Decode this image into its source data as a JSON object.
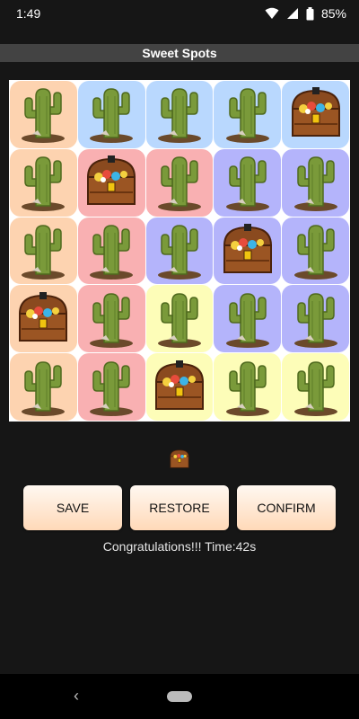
{
  "status": {
    "time": "1:49",
    "battery": "85%"
  },
  "app": {
    "title": "Sweet Spots"
  },
  "board": {
    "rows": [
      [
        {
          "color": "orange",
          "item": "cactus"
        },
        {
          "color": "blue",
          "item": "cactus"
        },
        {
          "color": "blue",
          "item": "cactus"
        },
        {
          "color": "blue",
          "item": "cactus"
        },
        {
          "color": "blue",
          "item": "chest"
        }
      ],
      [
        {
          "color": "orange",
          "item": "cactus"
        },
        {
          "color": "pink",
          "item": "chest"
        },
        {
          "color": "pink",
          "item": "cactus"
        },
        {
          "color": "purple",
          "item": "cactus"
        },
        {
          "color": "purple",
          "item": "cactus"
        }
      ],
      [
        {
          "color": "orange",
          "item": "cactus"
        },
        {
          "color": "pink",
          "item": "cactus"
        },
        {
          "color": "purple",
          "item": "cactus"
        },
        {
          "color": "purple",
          "item": "chest"
        },
        {
          "color": "purple",
          "item": "cactus"
        }
      ],
      [
        {
          "color": "orange",
          "item": "chest"
        },
        {
          "color": "pink",
          "item": "cactus"
        },
        {
          "color": "yellow",
          "item": "cactus"
        },
        {
          "color": "purple",
          "item": "cactus"
        },
        {
          "color": "purple",
          "item": "cactus"
        }
      ],
      [
        {
          "color": "orange",
          "item": "cactus"
        },
        {
          "color": "pink",
          "item": "cactus"
        },
        {
          "color": "yellow",
          "item": "chest"
        },
        {
          "color": "yellow",
          "item": "cactus"
        },
        {
          "color": "yellow",
          "item": "cactus"
        }
      ]
    ]
  },
  "selected_item_icon": "treasure-chest-icon",
  "buttons": {
    "save": "SAVE",
    "restore": "RESTORE",
    "confirm": "CONFIRM"
  },
  "message": "Congratulations!!! Time:42s",
  "colors": {
    "orange": "#fdd3b0",
    "blue": "#b9d8fe",
    "pink": "#f9b0b2",
    "purple": "#b4b4fb",
    "yellow": "#fdfdb8"
  }
}
